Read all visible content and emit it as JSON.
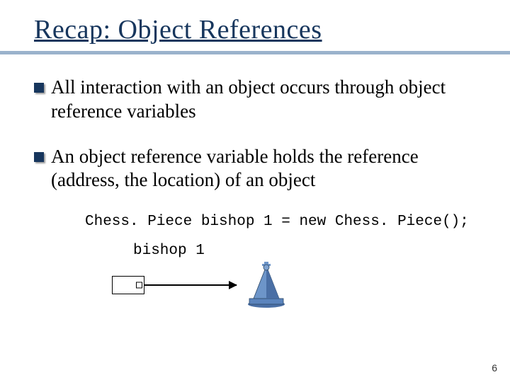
{
  "title": "Recap: Object References",
  "bullets": [
    "All interaction with an object occurs through object reference variables",
    "An object reference variable holds the reference (address, the location) of an object"
  ],
  "code_line": "Chess. Piece bishop 1 = new Chess. Piece();",
  "var_label": "bishop 1",
  "page_number": "6"
}
